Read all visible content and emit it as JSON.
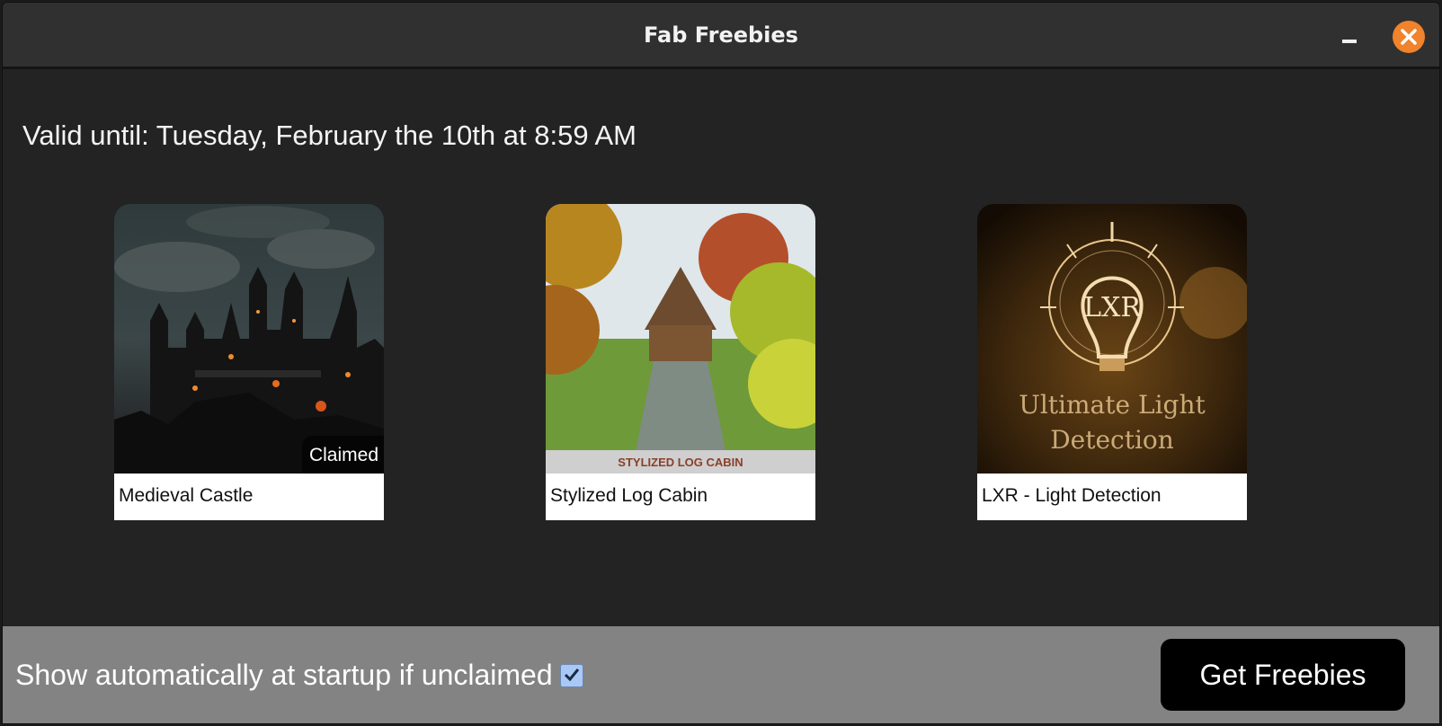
{
  "window": {
    "title": "Fab Freebies"
  },
  "valid_until": "Valid until: Tuesday, February the 10th at 8:59 AM",
  "cards": [
    {
      "name": "Medieval Castle",
      "badge": "Claimed"
    },
    {
      "name": "Stylized Log Cabin",
      "image_caption": "STYLIZED LOG CABIN"
    },
    {
      "name": "LXR - Light Detection",
      "image_logo": "LXR",
      "image_text_line1": "Ultimate Light",
      "image_text_line2": "Detection"
    }
  ],
  "footer": {
    "startup_label": "Show automatically at startup if unclaimed",
    "startup_checked": true,
    "get_button": "Get Freebies"
  },
  "colors": {
    "close_button": "#f0832b",
    "checkbox": "#a9c8f5",
    "footer": "#838383"
  }
}
